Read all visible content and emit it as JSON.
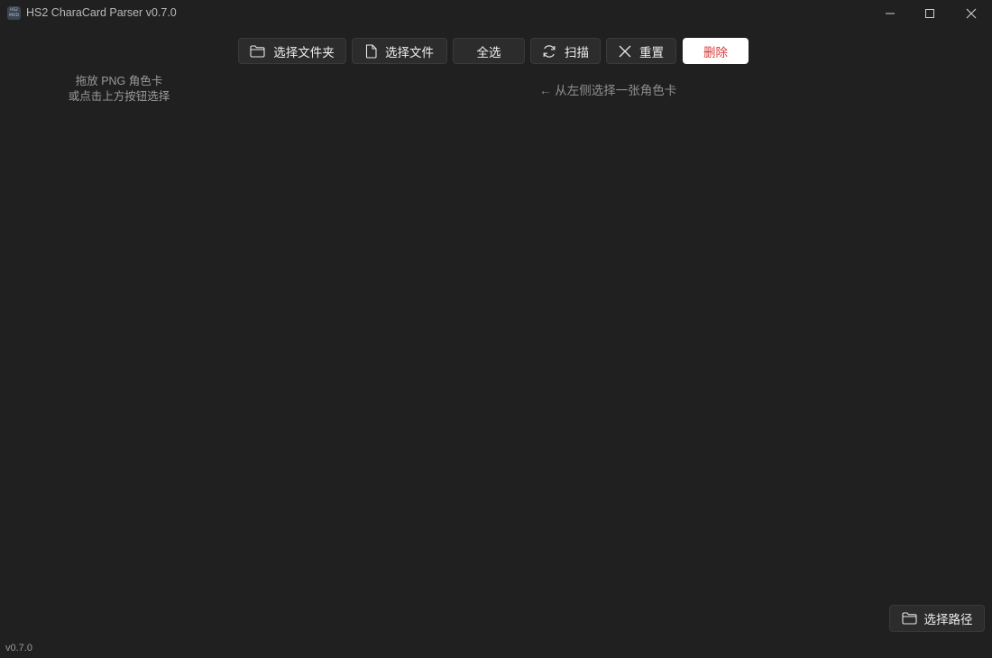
{
  "window": {
    "title": "HS2 CharaCard Parser v0.7.0",
    "icon_text_top": "HS2",
    "icon_text_bottom": "MOD"
  },
  "toolbar": {
    "select_folder": "选择文件夹",
    "select_file": "选择文件",
    "select_all": "全选",
    "scan": "扫描",
    "reset": "重置",
    "delete": "删除"
  },
  "sidebar": {
    "drop_hint_line1": "拖放 PNG 角色卡",
    "drop_hint_line2": "或点击上方按钮选择"
  },
  "main": {
    "select_hint": "← 从左侧选择一张角色卡"
  },
  "footer": {
    "select_path": "选择路径",
    "version": "v0.7.0"
  },
  "colors": {
    "background": "#202020",
    "button": "#2c2c2c",
    "danger_text": "#d73a3a"
  },
  "icons": {
    "select_folder": "folder-icon",
    "select_file": "file-icon",
    "scan": "refresh-icon",
    "reset": "close-icon",
    "select_path": "folder-icon"
  }
}
